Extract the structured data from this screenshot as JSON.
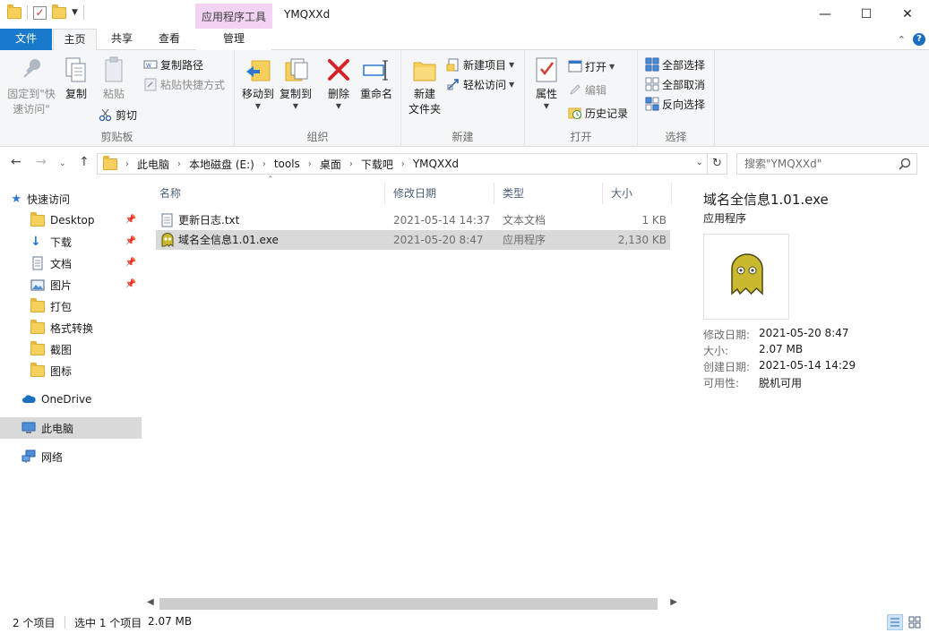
{
  "titlebar": {
    "context_tab_header": "应用程序工具",
    "window_title": "YMQXXd",
    "minimize": "—",
    "maximize": "☐",
    "close": "✕"
  },
  "ribbon_tabs": {
    "file": "文件",
    "home": "主页",
    "share": "共享",
    "view": "查看",
    "manage": "管理"
  },
  "ribbon": {
    "clipboard": {
      "label": "剪贴板",
      "pin_quick_access": [
        "固定到\"快",
        "速访问\""
      ],
      "copy": "复制",
      "paste": "粘贴",
      "copy_path": "复制路径",
      "paste_shortcut": "粘贴快捷方式",
      "cut": "剪切"
    },
    "organize": {
      "label": "组织",
      "move_to": "移动到",
      "copy_to": "复制到",
      "delete": "删除",
      "rename": "重命名"
    },
    "new": {
      "label": "新建",
      "new_folder": [
        "新建",
        "文件夹"
      ],
      "new_item": "新建项目",
      "easy_access": "轻松访问"
    },
    "open": {
      "label": "打开",
      "properties": "属性",
      "open": "打开",
      "edit": "编辑",
      "history": "历史记录"
    },
    "select": {
      "label": "选择",
      "select_all": "全部选择",
      "select_none": "全部取消",
      "invert": "反向选择"
    }
  },
  "address": {
    "crumbs": [
      "此电脑",
      "本地磁盘 (E:)",
      "tools",
      "桌面",
      "下载吧",
      "YMQXXd"
    ],
    "search_placeholder": "搜索\"YMQXXd\""
  },
  "nav": {
    "quick_access": "快速访问",
    "items": [
      {
        "label": "Desktop",
        "pinned": true
      },
      {
        "label": "下载",
        "pinned": true
      },
      {
        "label": "文档",
        "pinned": true
      },
      {
        "label": "图片",
        "pinned": true
      },
      {
        "label": "打包",
        "pinned": false
      },
      {
        "label": "格式转换",
        "pinned": false
      },
      {
        "label": "截图",
        "pinned": false
      },
      {
        "label": "图标",
        "pinned": false
      }
    ],
    "onedrive": "OneDrive",
    "this_pc": "此电脑",
    "network": "网络"
  },
  "list": {
    "columns": {
      "name": "名称",
      "modified": "修改日期",
      "type": "类型",
      "size": "大小"
    },
    "rows": [
      {
        "name": "更新日志.txt",
        "modified": "2021-05-14 14:37",
        "type": "文本文档",
        "size": "1 KB",
        "selected": false
      },
      {
        "name": "域名全信息1.01.exe",
        "modified": "2021-05-20 8:47",
        "type": "应用程序",
        "size": "2,130 KB",
        "selected": true
      }
    ]
  },
  "details": {
    "title": "域名全信息1.01.exe",
    "type": "应用程序",
    "props": [
      {
        "label": "修改日期:",
        "value": "2021-05-20 8:47"
      },
      {
        "label": "大小:",
        "value": "2.07 MB"
      },
      {
        "label": "创建日期:",
        "value": "2021-05-14 14:29"
      },
      {
        "label": "可用性:",
        "value": "脱机可用"
      }
    ]
  },
  "status": {
    "item_count": "2 个项目",
    "selection": "选中 1 个项目",
    "selection_size": "2.07 MB"
  },
  "colors": {
    "accent": "#1979ca",
    "context_tab": "#f2d3f3",
    "selection": "#d9d9d9",
    "ribbon_bg": "#f5f6f7"
  }
}
